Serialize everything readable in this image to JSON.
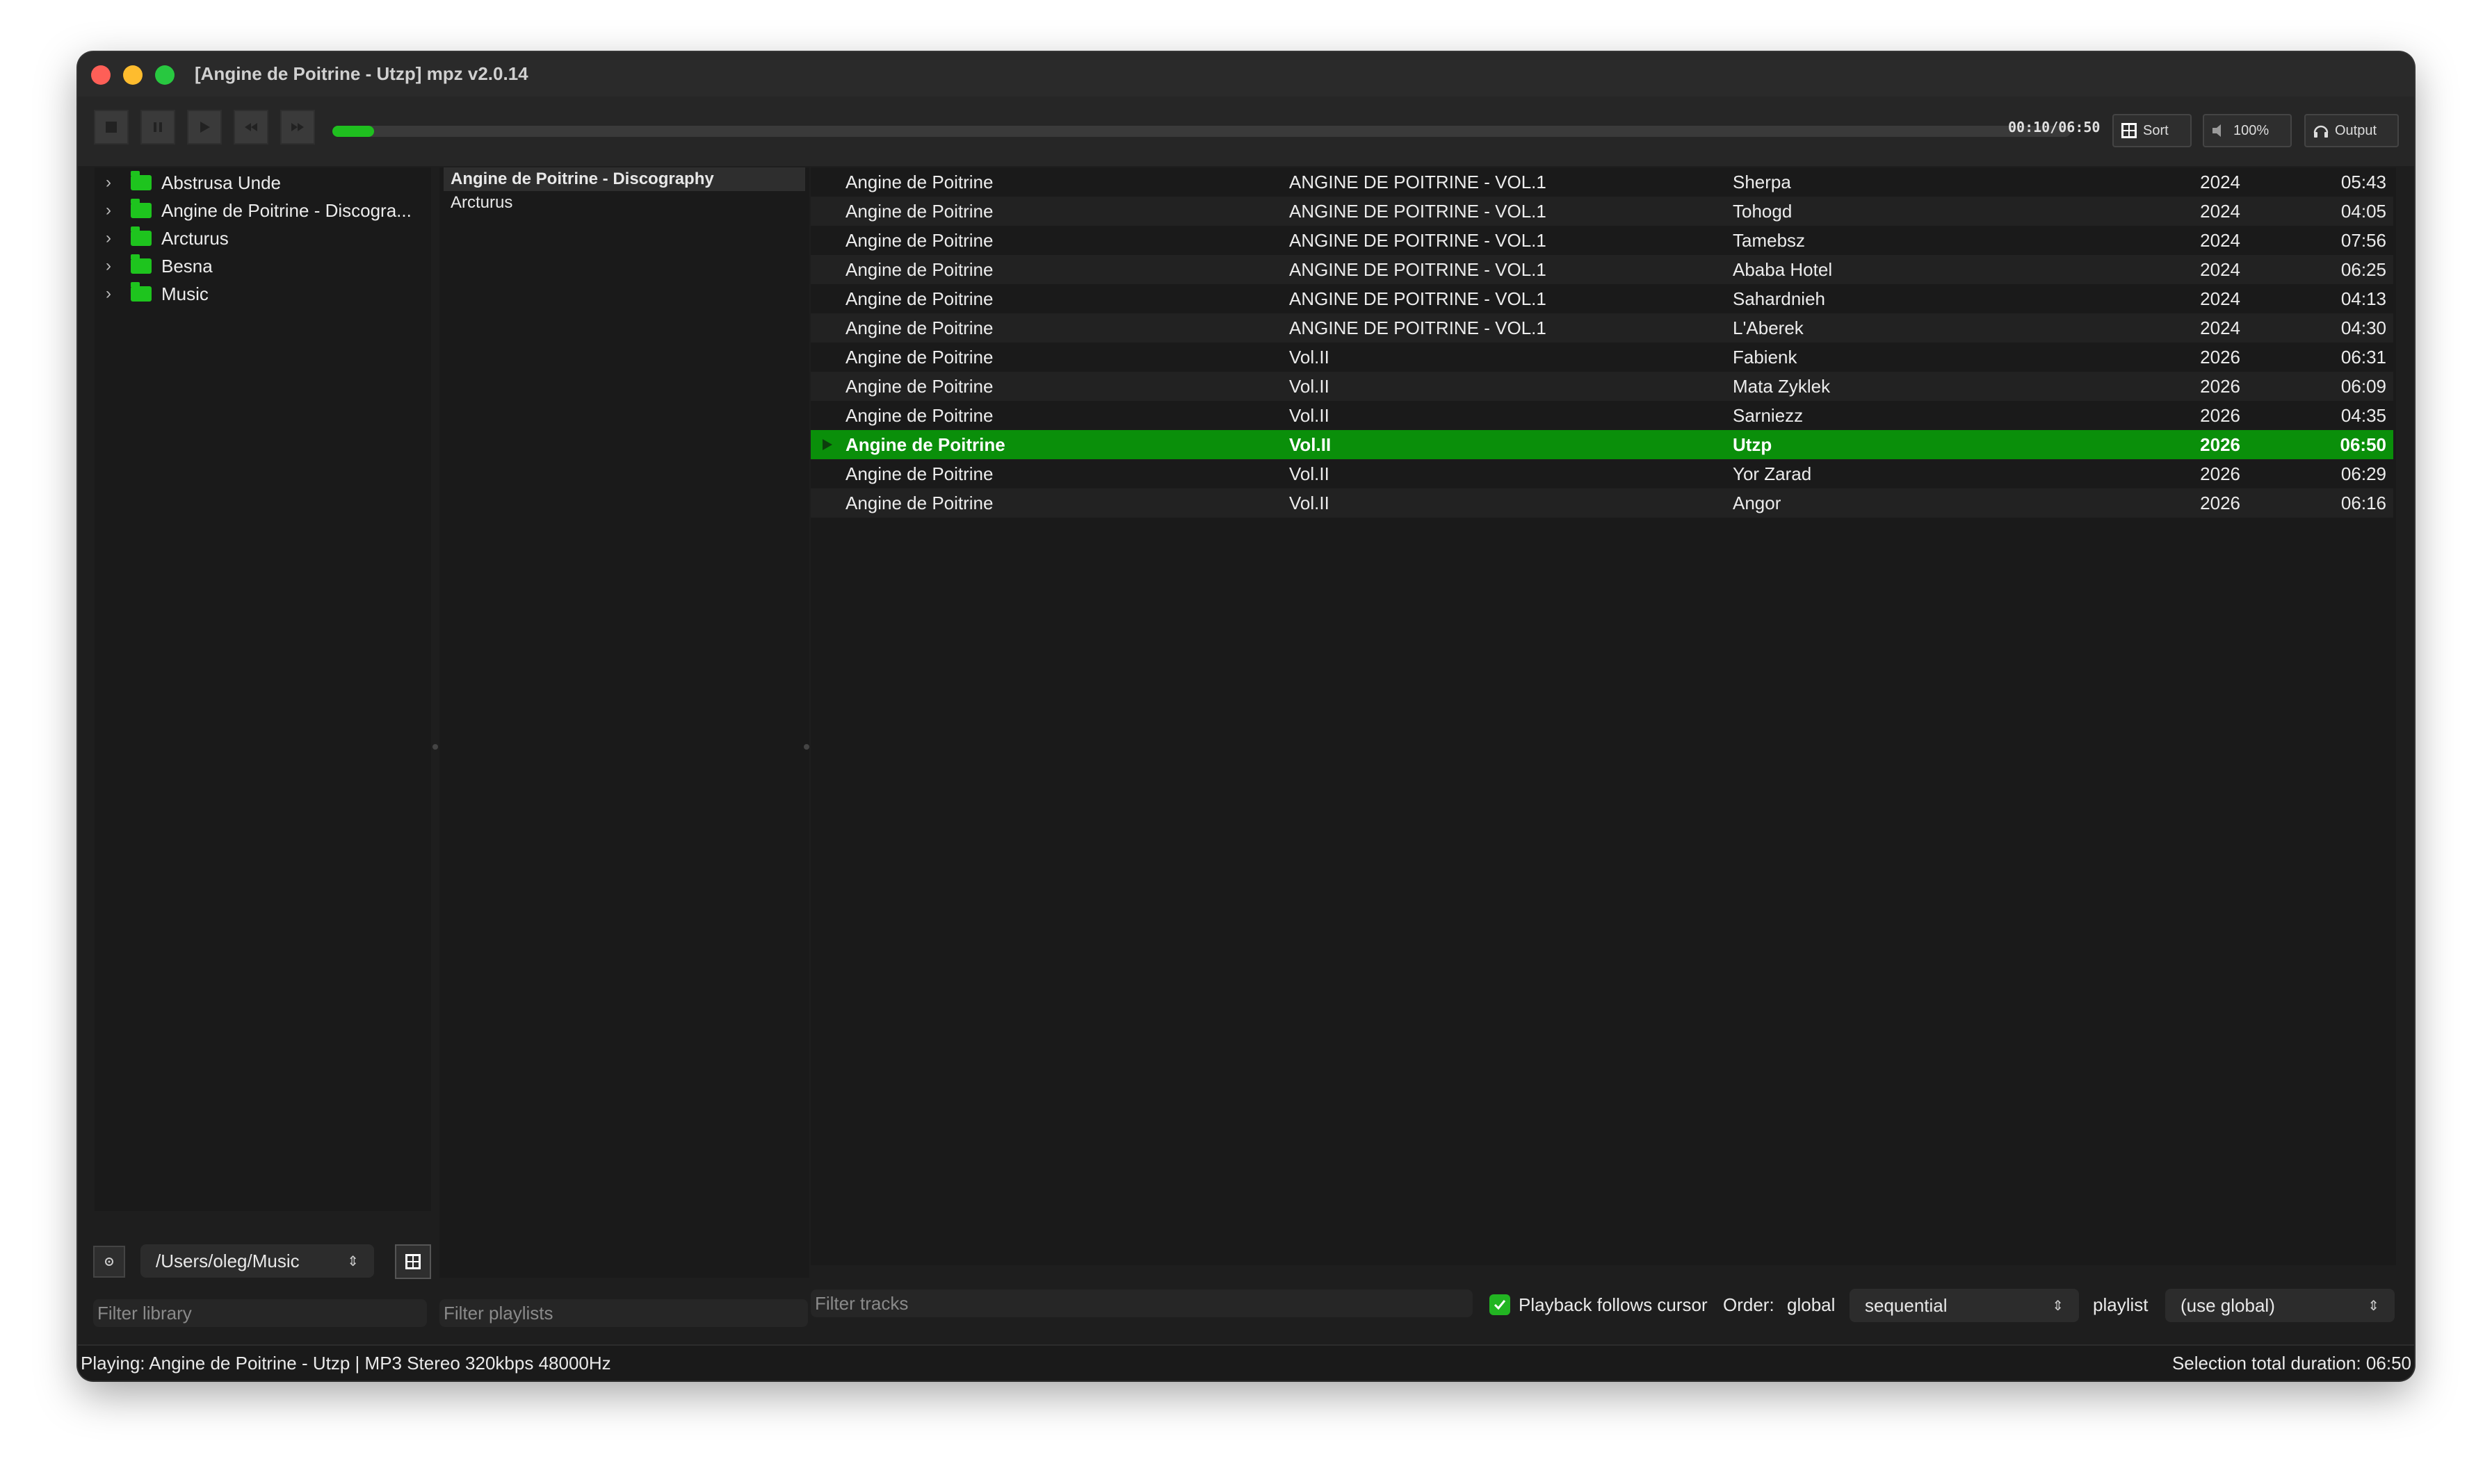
{
  "window": {
    "title": "[Angine de Poitrine - Utzp] mpz v2.0.14"
  },
  "toolbar": {
    "progress": 0.024,
    "time": "00:10/06:50",
    "sort_label": "Sort",
    "volume_label": "100%",
    "output_label": "Output",
    "icons": [
      "stop-icon",
      "pause-icon",
      "play-icon",
      "prev-icon",
      "next-icon"
    ]
  },
  "library": {
    "folders": [
      {
        "label": "Abstrusa Unde"
      },
      {
        "label": "Angine de Poitrine - Discogra..."
      },
      {
        "label": "Arcturus"
      },
      {
        "label": "Besna"
      },
      {
        "label": "Music"
      }
    ],
    "path": "/Users/oleg/Music",
    "filter_placeholder": "Filter library"
  },
  "playlists": {
    "items": [
      {
        "label": "Angine de Poitrine - Discography",
        "active": true
      },
      {
        "label": "Arcturus",
        "active": false
      }
    ],
    "filter_placeholder": "Filter playlists"
  },
  "tracks": [
    {
      "artist": "Angine de Poitrine",
      "album": "ANGINE DE POITRINE - VOL.1",
      "title": "Sherpa",
      "year": "2024",
      "duration": "05:43"
    },
    {
      "artist": "Angine de Poitrine",
      "album": "ANGINE DE POITRINE - VOL.1",
      "title": "Tohogd",
      "year": "2024",
      "duration": "04:05"
    },
    {
      "artist": "Angine de Poitrine",
      "album": "ANGINE DE POITRINE - VOL.1",
      "title": "Tamebsz",
      "year": "2024",
      "duration": "07:56"
    },
    {
      "artist": "Angine de Poitrine",
      "album": "ANGINE DE POITRINE - VOL.1",
      "title": "Ababa Hotel",
      "year": "2024",
      "duration": "06:25"
    },
    {
      "artist": "Angine de Poitrine",
      "album": "ANGINE DE POITRINE - VOL.1",
      "title": "Sahardnieh",
      "year": "2024",
      "duration": "04:13"
    },
    {
      "artist": "Angine de Poitrine",
      "album": "ANGINE DE POITRINE - VOL.1",
      "title": "L'Aberek",
      "year": "2024",
      "duration": "04:30"
    },
    {
      "artist": "Angine de Poitrine",
      "album": "Vol.II",
      "title": "Fabienk",
      "year": "2026",
      "duration": "06:31"
    },
    {
      "artist": "Angine de Poitrine",
      "album": "Vol.II",
      "title": "Mata Zyklek",
      "year": "2026",
      "duration": "06:09"
    },
    {
      "artist": "Angine de Poitrine",
      "album": "Vol.II",
      "title": "Sarniezz",
      "year": "2026",
      "duration": "04:35"
    },
    {
      "artist": "Angine de Poitrine",
      "album": "Vol.II",
      "title": "Utzp",
      "year": "2026",
      "duration": "06:50",
      "playing": true
    },
    {
      "artist": "Angine de Poitrine",
      "album": "Vol.II",
      "title": "Yor Zarad",
      "year": "2026",
      "duration": "06:29"
    },
    {
      "artist": "Angine de Poitrine",
      "album": "Vol.II",
      "title": "Angor",
      "year": "2026",
      "duration": "06:16"
    }
  ],
  "bottom": {
    "filter_tracks_placeholder": "Filter tracks",
    "follow_cursor_label": "Playback follows cursor",
    "follow_cursor_checked": true,
    "order_label": "Order:",
    "global_label": "global",
    "global_order": "sequential",
    "playlist_label": "playlist",
    "playlist_order": "(use global)"
  },
  "status": {
    "left": "Playing: Angine de Poitrine - Utzp | MP3 Stereo 320kbps 48000Hz",
    "right": "Selection total duration: 06:50"
  },
  "colors": {
    "accent": "#1ec41e",
    "selection": "#0a8f0a",
    "background": "#1e1e1e"
  }
}
